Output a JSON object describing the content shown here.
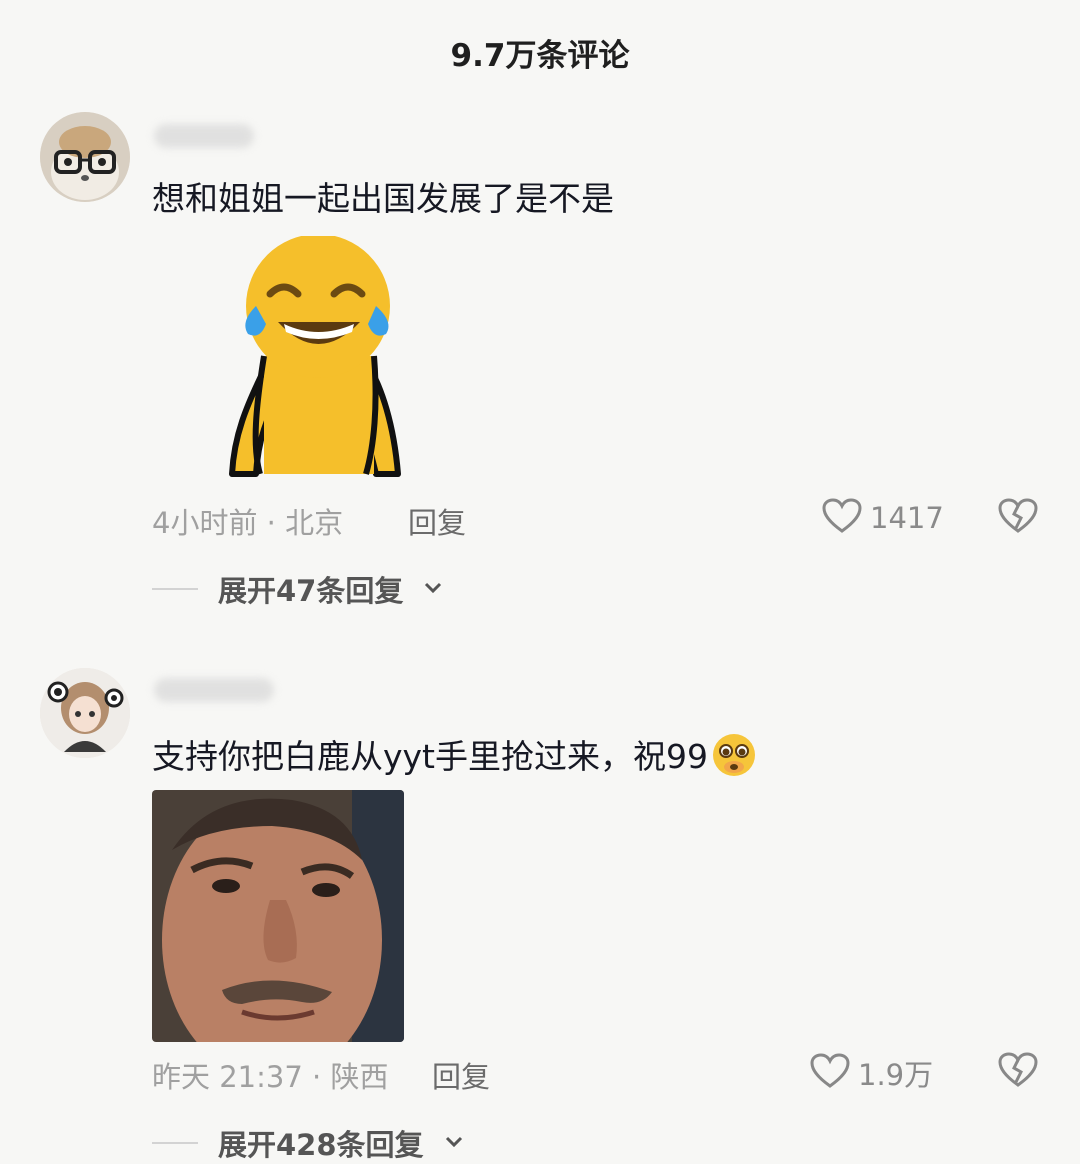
{
  "header": {
    "title": "9.7万条评论"
  },
  "comments": [
    {
      "text": "想和姐姐一起出国发展了是不是",
      "time_location": "4小时前 · 北京",
      "reply_label": "回复",
      "likes": "1417",
      "expand_label": "展开47条回复"
    },
    {
      "text": "支持你把白鹿从yyt手里抢过来，祝99",
      "time_location": "昨天 21:37 · 陕西",
      "reply_label": "回复",
      "likes": "1.9万",
      "expand_label": "展开428条回复"
    }
  ],
  "colors": {
    "background": "#f7f7f5",
    "meme_yellow": "#f5bf2b",
    "tear_blue": "#3aa0e8"
  }
}
